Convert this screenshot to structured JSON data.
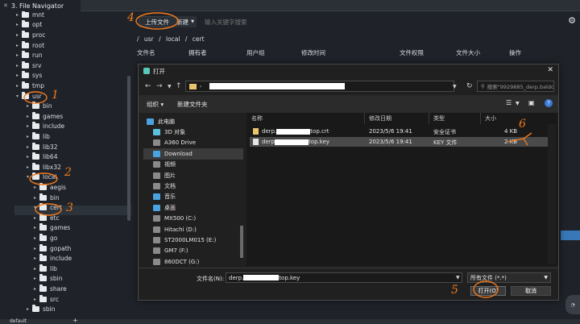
{
  "tab": {
    "title": "3. File Navigator"
  },
  "tree": {
    "items": [
      {
        "label": "mnt",
        "depth": 0,
        "expanded": false
      },
      {
        "label": "opt",
        "depth": 0,
        "expanded": false
      },
      {
        "label": "proc",
        "depth": 0,
        "expanded": false
      },
      {
        "label": "root",
        "depth": 0,
        "expanded": false
      },
      {
        "label": "run",
        "depth": 0,
        "expanded": false
      },
      {
        "label": "srv",
        "depth": 0,
        "expanded": false
      },
      {
        "label": "sys",
        "depth": 0,
        "expanded": false
      },
      {
        "label": "tmp",
        "depth": 0,
        "expanded": false
      },
      {
        "label": "usr",
        "depth": 0,
        "expanded": true
      },
      {
        "label": "bin",
        "depth": 1,
        "expanded": false
      },
      {
        "label": "games",
        "depth": 1,
        "expanded": false
      },
      {
        "label": "include",
        "depth": 1,
        "expanded": false
      },
      {
        "label": "lib",
        "depth": 1,
        "expanded": false
      },
      {
        "label": "lib32",
        "depth": 1,
        "expanded": false
      },
      {
        "label": "lib64",
        "depth": 1,
        "expanded": false
      },
      {
        "label": "libx32",
        "depth": 1,
        "expanded": false
      },
      {
        "label": "local",
        "depth": 1,
        "expanded": true
      },
      {
        "label": "aegis",
        "depth": 2,
        "expanded": false
      },
      {
        "label": "bin",
        "depth": 2,
        "expanded": false
      },
      {
        "label": "cert",
        "depth": 2,
        "expanded": true,
        "selected": true
      },
      {
        "label": "etc",
        "depth": 2,
        "expanded": false
      },
      {
        "label": "games",
        "depth": 2,
        "expanded": false
      },
      {
        "label": "go",
        "depth": 2,
        "expanded": false
      },
      {
        "label": "gopath",
        "depth": 2,
        "expanded": false
      },
      {
        "label": "include",
        "depth": 2,
        "expanded": false
      },
      {
        "label": "lib",
        "depth": 2,
        "expanded": false
      },
      {
        "label": "sbin",
        "depth": 2,
        "expanded": false
      },
      {
        "label": "share",
        "depth": 2,
        "expanded": false
      },
      {
        "label": "src",
        "depth": 2,
        "expanded": false
      },
      {
        "label": "sbin",
        "depth": 1,
        "expanded": false
      }
    ]
  },
  "toolbar": {
    "upload_label": "上传文件",
    "new_label": "新建",
    "keyword_placeholder": "输入关键字搜索"
  },
  "breadcrumb": {
    "parts": [
      "/",
      "usr",
      "/",
      "local",
      "/",
      "cert"
    ]
  },
  "file_columns": [
    "文件名",
    "拥有者",
    "用户组",
    "修改时间",
    "文件权限",
    "文件大小",
    "操作"
  ],
  "dialog": {
    "title": "打开",
    "search_placeholder": "搜索\"9929885_derp.baldc...",
    "organize_label": "组织 ▾",
    "new_folder_label": "新建文件夹",
    "places": [
      {
        "label": "此电脑",
        "color": "#4aa3df"
      },
      {
        "label": "3D 对象",
        "color": "#5bc0de"
      },
      {
        "label": "A360 Drive",
        "color": "#8a8a8a"
      },
      {
        "label": "Download",
        "color": "#4aa3df",
        "selected": true
      },
      {
        "label": "视频",
        "color": "#8a8a8a"
      },
      {
        "label": "图片",
        "color": "#8a8a8a"
      },
      {
        "label": "文档",
        "color": "#8a8a8a"
      },
      {
        "label": "音乐",
        "color": "#4aa3df"
      },
      {
        "label": "桌面",
        "color": "#4aa3df"
      },
      {
        "label": "MX500 (C:)",
        "color": "#8a8a8a"
      },
      {
        "label": "Hitachi (D:)",
        "color": "#8a8a8a"
      },
      {
        "label": "ST2000LM015 (E:)",
        "color": "#8a8a8a"
      },
      {
        "label": "GM7 (F:)",
        "color": "#8a8a8a"
      },
      {
        "label": "860DCT (G:)",
        "color": "#8a8a8a"
      }
    ],
    "columns": {
      "name": "名称",
      "date": "修改日期",
      "type": "类型",
      "size": "大小"
    },
    "files": [
      {
        "name_prefix": "derp.",
        "name_suffix": "top.crt",
        "date": "2023/5/6 19:41",
        "type": "安全证书",
        "size": "4 KB"
      },
      {
        "name_prefix": "derp",
        "name_suffix": "top.key",
        "date": "2023/5/6 19:41",
        "type": "KEY 文件",
        "size": "2 KB",
        "selected": true
      }
    ],
    "filename_label": "文件名(N):",
    "filename_prefix": "derp.",
    "filename_suffix": "top.key",
    "filetype_label": "所有文件 (*.*)",
    "open_label": "打开(O)",
    "cancel_label": "取消"
  },
  "annotations": [
    "1",
    "2",
    "3",
    "4",
    "5",
    "6"
  ],
  "bottom": {
    "label": "default",
    "plus": "+"
  },
  "accent_annotation": "#f07a1d"
}
